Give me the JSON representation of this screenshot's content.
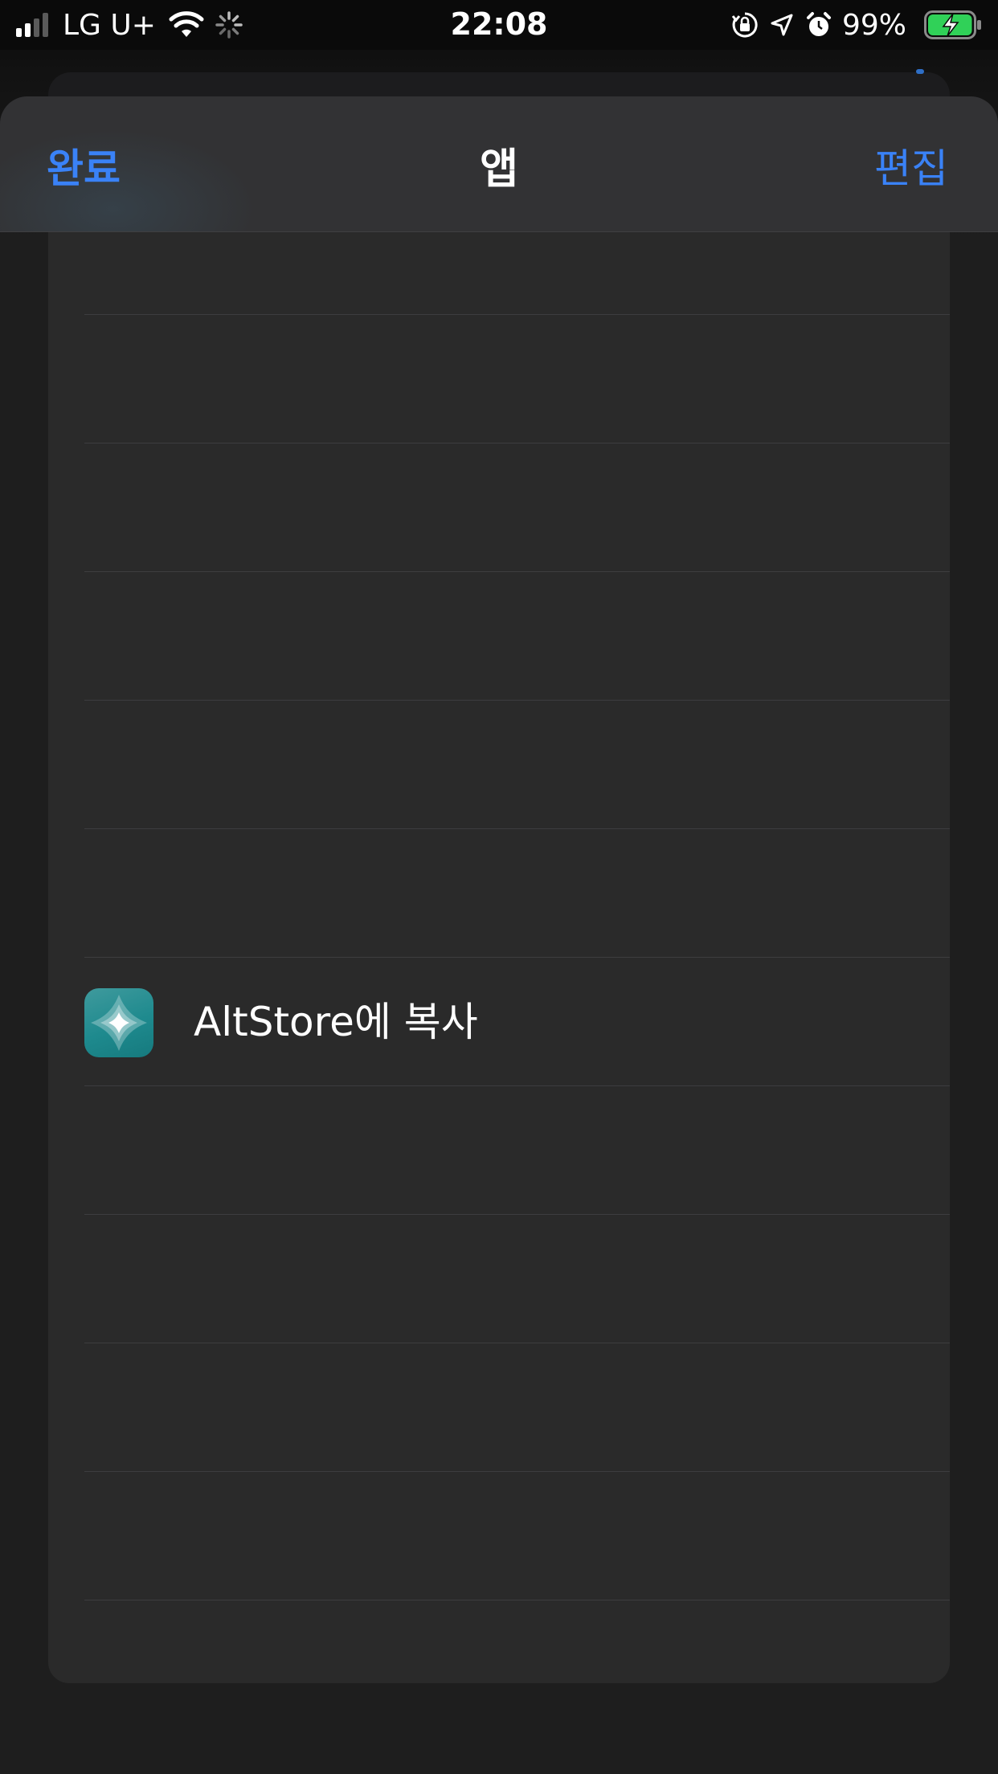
{
  "status_bar": {
    "carrier": "LG U+",
    "time": "22:08",
    "battery_percent": "99%",
    "battery_level": 0.99,
    "signal_bars_active": 2,
    "signal_bars_total": 4,
    "icons": [
      "signal-icon",
      "wifi-icon",
      "activity-spinner-icon",
      "orientation-lock-icon",
      "location-arrow-icon",
      "alarm-icon",
      "battery-charging-icon"
    ],
    "battery_color": "#30d158"
  },
  "nav": {
    "left_label": "완료",
    "title": "앱",
    "right_label": "편집",
    "accent_color": "#3a82f7"
  },
  "list": {
    "rows": [
      {
        "label": ""
      },
      {
        "label": ""
      },
      {
        "label": ""
      },
      {
        "label": ""
      },
      {
        "label": ""
      },
      {
        "label": ""
      },
      {
        "label": "AltStore에 복사",
        "icon": "altstore-app-icon"
      },
      {
        "label": ""
      },
      {
        "label": ""
      },
      {
        "label": ""
      },
      {
        "label": ""
      }
    ]
  }
}
